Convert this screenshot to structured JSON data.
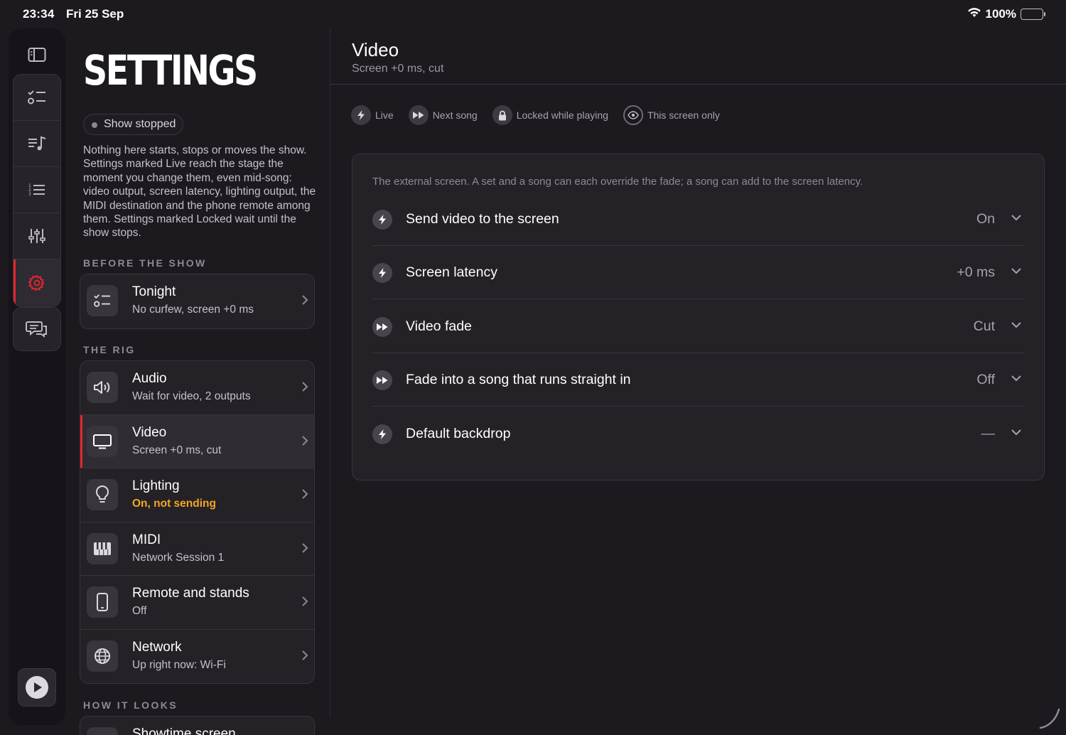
{
  "status_bar": {
    "time": "23:34",
    "date": "Fri 25 Sep",
    "battery": "100%"
  },
  "rail": {
    "items": [
      "sidebar-toggle",
      "checklist",
      "song-list",
      "setlist",
      "mixer",
      "settings",
      "messages"
    ],
    "active": "settings",
    "play_label": "Play"
  },
  "settings": {
    "title": "SETTINGS",
    "status_pill": "Show stopped",
    "intro": "Nothing here starts, stops or moves the show. Settings marked Live reach the stage the moment you change them, even mid-song: video output, screen latency, lighting output, the MIDI destination and the phone remote among them. Settings marked Locked wait until the show stops.",
    "sections": [
      {
        "label": "BEFORE THE SHOW",
        "rows": [
          {
            "title": "Tonight",
            "subtitle": "No curfew, screen +0 ms",
            "icon": "checklist-icon"
          }
        ]
      },
      {
        "label": "THE RIG",
        "rows": [
          {
            "title": "Audio",
            "subtitle": "Wait for video, 2 outputs",
            "icon": "speaker-icon"
          },
          {
            "title": "Video",
            "subtitle": "Screen +0 ms, cut",
            "icon": "monitor-icon"
          },
          {
            "title": "Lighting",
            "subtitle": "On, not sending",
            "icon": "bulb-icon"
          },
          {
            "title": "MIDI",
            "subtitle": "Network Session 1",
            "icon": "piano-icon"
          },
          {
            "title": "Remote and stands",
            "subtitle": "Off",
            "icon": "phone-icon"
          },
          {
            "title": "Network",
            "subtitle": "Up right now: Wi-Fi",
            "icon": "globe-icon"
          }
        ]
      },
      {
        "label": "HOW IT LOOKS",
        "rows": [
          {
            "title": "Showtime screen",
            "subtitle": "",
            "icon": "screen-icon"
          }
        ]
      }
    ]
  },
  "detail": {
    "title": "Video",
    "subtitle": "Screen +0 ms, cut",
    "legend": [
      {
        "label": "Live",
        "icon": "bolt-icon"
      },
      {
        "label": "Next song",
        "icon": "fast-forward-icon"
      },
      {
        "label": "Locked while playing",
        "icon": "lock-icon"
      },
      {
        "label": "This screen only",
        "icon": "eye-icon"
      }
    ],
    "description": "The external screen. A set and a song can each override the fade; a song can add to the screen latency.",
    "rows": [
      {
        "label": "Send video to the screen",
        "value": "On",
        "icon": "bolt-icon"
      },
      {
        "label": "Screen latency",
        "value": "+0 ms",
        "icon": "bolt-icon"
      },
      {
        "label": "Video fade",
        "value": "Cut",
        "icon": "fast-forward-icon"
      },
      {
        "label": "Fade into a song that runs straight in",
        "value": "Off",
        "icon": "fast-forward-icon"
      },
      {
        "label": "Default backdrop",
        "value": "—",
        "icon": "bolt-icon"
      }
    ]
  },
  "colors": {
    "accent": "#e0282d",
    "warning": "#f5a623",
    "background": "#1c1a1f"
  }
}
